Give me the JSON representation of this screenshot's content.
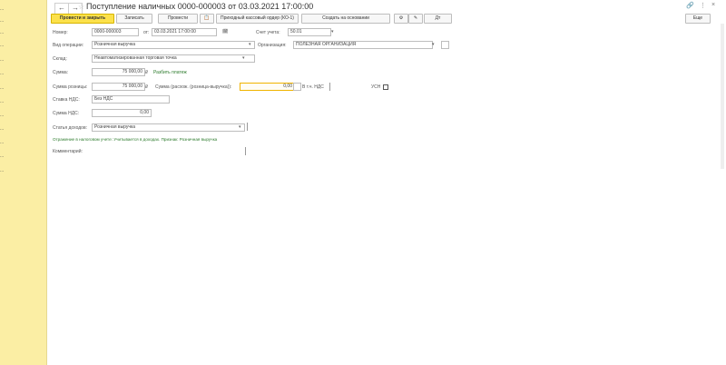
{
  "sidebar": {
    "items": [
      "...",
      "...",
      "...",
      "...",
      "...",
      "...",
      "...",
      "...",
      "...",
      "...",
      "...",
      "...",
      "...",
      "..."
    ]
  },
  "header": {
    "back_icon": "←",
    "forward_icon": "→",
    "title": "Поступление наличных 0000-000003 от 03.03.2021 17:00:00",
    "link_icon": "🔗",
    "more_icon": "⋮",
    "close_icon": "×"
  },
  "toolbar": {
    "post_close": "Провести и закрыть",
    "write": "Записать",
    "post": "Провести",
    "print": "Приходный кассовый ордер (КО-1)",
    "create_basis": "Создать на основании",
    "more": "Еще"
  },
  "form": {
    "number_label": "Номер:",
    "number_value": "0000-000003",
    "date_label": "от:",
    "date_value": "03.03.2021 17:00:00",
    "account_label": "Счет учета:",
    "account_value": "50.01",
    "op_type_label": "Вид операции:",
    "op_type_value": "Розничная выручка",
    "counterparty_label": "Организация:",
    "counterparty_value": "ПОЛЕЗНАЯ ОРГАНИЗАЦИЯ",
    "warehouse_label": "Склад:",
    "warehouse_value": "Неавтоматизированная торговая точка",
    "sum_label": "Сумма:",
    "sum_value": "75 000,00",
    "sum_currency": "₽",
    "sum_link": "Разбить платеж",
    "retail_sum_label": "Сумма розницы:",
    "retail_sum_value": "75 000,00",
    "retail_diff_label": "Сумма (расхож. (розница-выручка)):",
    "retail_diff_value": "0,00",
    "vat_label": "В т.ч. НДС",
    "usn_label": "УСН",
    "vat_rate_label": "Ставка НДС:",
    "vat_rate_value": "Без НДС",
    "vat_sum_label": "Сумма НДС:",
    "vat_sum_value": "0,00",
    "article_label": "Статья доходов:",
    "article_value": "Розничная выручка",
    "hint": "Отражение в налоговом учете: Учитывается в доходах. Признак: Розничная выручка",
    "comment_label": "Комментарий:"
  }
}
